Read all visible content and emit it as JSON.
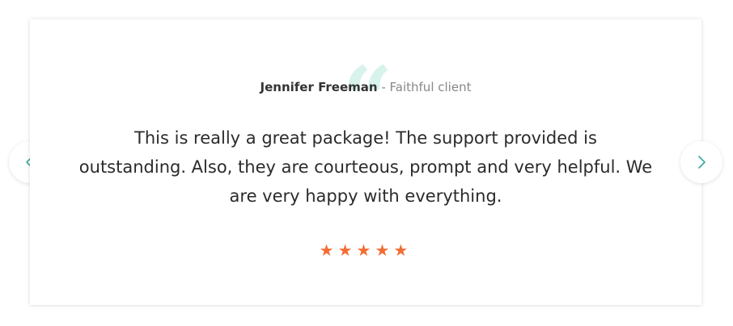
{
  "testimonial": {
    "author_name": "Jennifer Freeman",
    "author_separator": " - ",
    "author_role": "Faithful client",
    "quote_glyph": "“",
    "text": "This is really a great package! The support provided is outstanding. Also, they are courteous, prompt and very helpful. We are very happy with everything.",
    "rating": 5,
    "stars": "★★★★★"
  },
  "colors": {
    "accent": "#2a9d8f",
    "quote_mark": "#d7f3ec",
    "star": "#f26d34"
  },
  "icons": {
    "prev": "chevron-left-icon",
    "next": "chevron-right-icon"
  }
}
